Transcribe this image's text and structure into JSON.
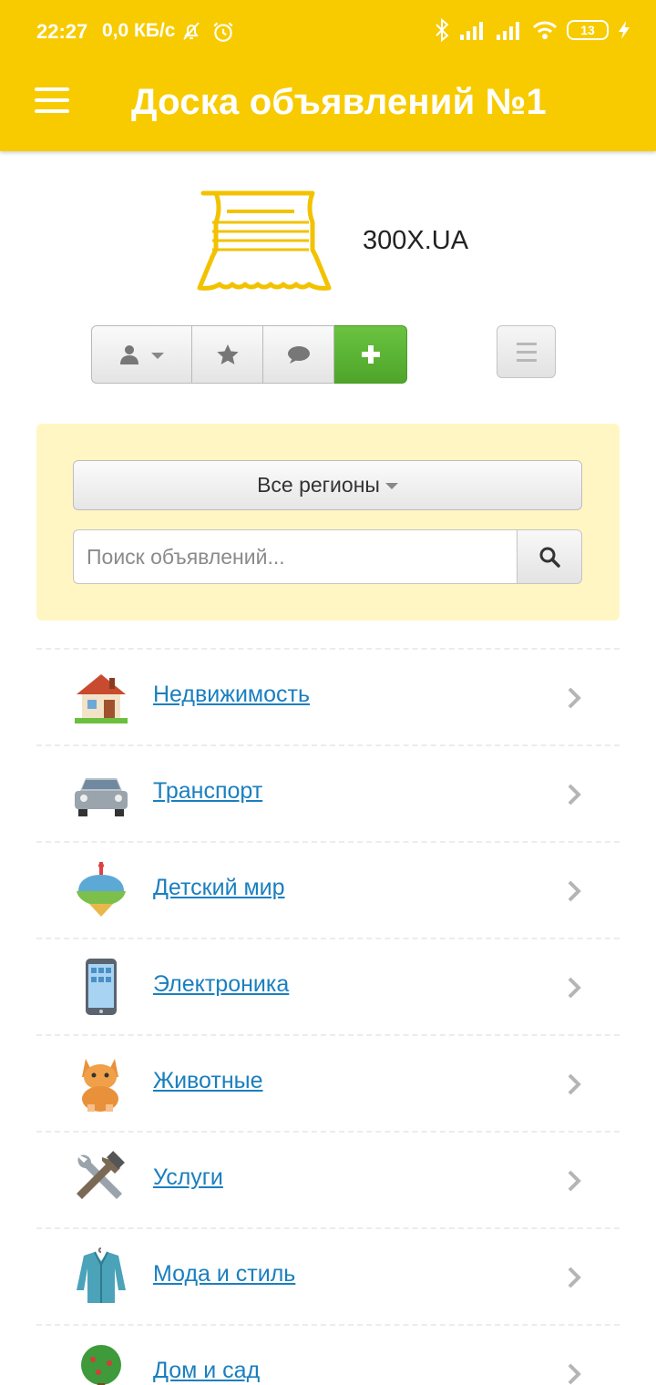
{
  "status_bar": {
    "time": "22:27",
    "speed": "0,0 КБ/с",
    "battery": "13"
  },
  "app_bar": {
    "title": "Доска объявлений №1"
  },
  "brand": {
    "name": "300X.UA"
  },
  "toolbar": {
    "user_icon": "user-icon",
    "favorites_icon": "star-icon",
    "messages_icon": "chat-bubble-icon",
    "add_icon": "plus-icon",
    "add_color": "#5cb536"
  },
  "search_panel": {
    "region_label": "Все регионы",
    "search_placeholder": "Поиск объявлений...",
    "search_value": "",
    "background": "#fff6c3"
  },
  "categories": [
    {
      "label": "Недвижимость",
      "icon": "house-icon"
    },
    {
      "label": "Транспорт",
      "icon": "car-icon"
    },
    {
      "label": "Детский мир",
      "icon": "spinning-top-icon"
    },
    {
      "label": "Электроника",
      "icon": "phone-icon"
    },
    {
      "label": "Животные",
      "icon": "cat-icon"
    },
    {
      "label": "Услуги",
      "icon": "tools-icon"
    },
    {
      "label": "Мода и стиль",
      "icon": "jacket-icon"
    },
    {
      "label": "Дом и сад",
      "icon": "tree-icon"
    }
  ],
  "colors": {
    "app_bar": "#f7cb00",
    "link": "#1a7fbf"
  }
}
